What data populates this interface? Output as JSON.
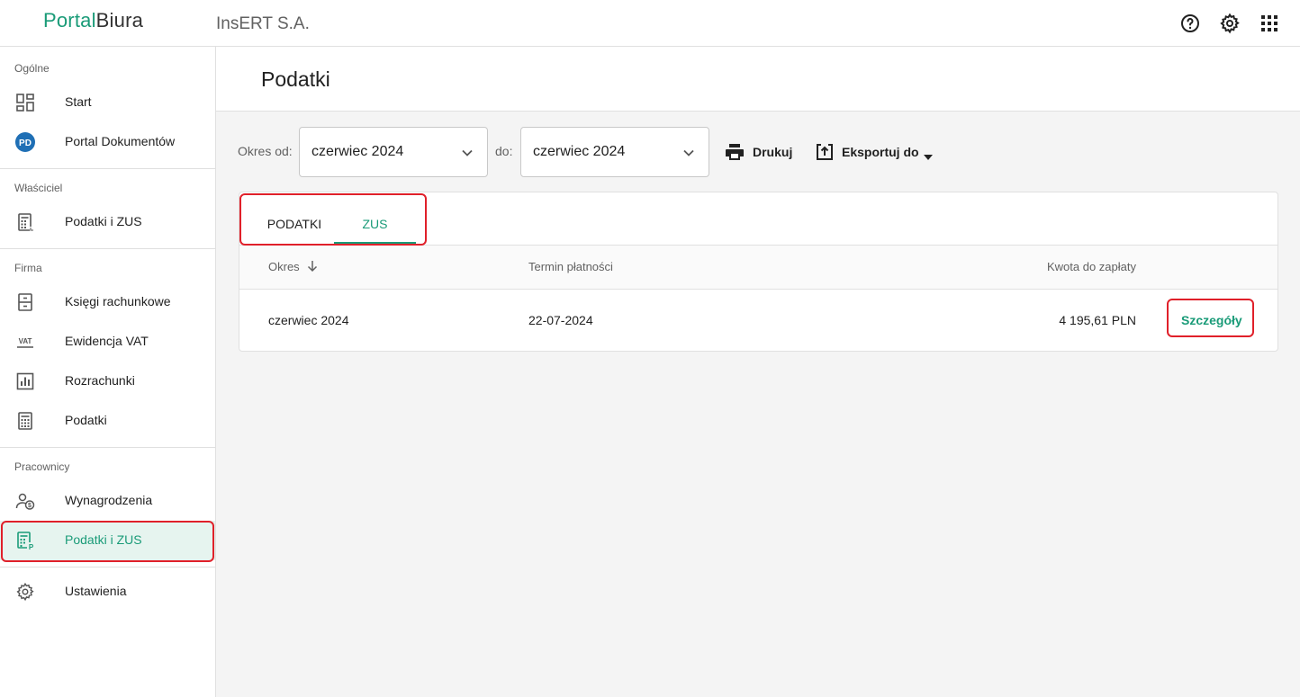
{
  "app": {
    "logo_part1": "Portal",
    "logo_part2": "Biura",
    "company": "InsERT S.A."
  },
  "topbar": {
    "icons": [
      "help-icon",
      "settings-icon",
      "apps-grid-icon"
    ]
  },
  "sidebar": {
    "sections": [
      {
        "label": "Ogólne",
        "items": [
          {
            "label": "Start",
            "icon": "dashboard-icon"
          },
          {
            "label": "Portal Dokumentów",
            "icon": "pd-avatar-icon",
            "badge": "PD"
          }
        ]
      },
      {
        "label": "Właściciel",
        "items": [
          {
            "label": "Podatki i ZUS",
            "icon": "calculator-icon"
          }
        ]
      },
      {
        "label": "Firma",
        "items": [
          {
            "label": "Księgi rachunkowe",
            "icon": "ledger-icon"
          },
          {
            "label": "Ewidencja VAT",
            "icon": "vat-icon",
            "badge": "VAT"
          },
          {
            "label": "Rozrachunki",
            "icon": "bar-chart-icon"
          },
          {
            "label": "Podatki",
            "icon": "calculator-icon"
          }
        ]
      },
      {
        "label": "Pracownicy",
        "items": [
          {
            "label": "Wynagrodzenia",
            "icon": "payroll-icon"
          },
          {
            "label": "Podatki i ZUS",
            "icon": "calculator-p-icon",
            "badge": "P",
            "active": true
          }
        ]
      }
    ],
    "settings": {
      "label": "Ustawienia",
      "icon": "gear-icon"
    }
  },
  "page": {
    "title": "Podatki"
  },
  "filters": {
    "from_label": "Okres od:",
    "from_value": "czerwiec 2024",
    "to_label": "do:",
    "to_value": "czerwiec 2024",
    "print_label": "Drukuj",
    "export_label": "Eksportuj do"
  },
  "tabs": [
    {
      "label": "PODATKI",
      "active": false
    },
    {
      "label": "ZUS",
      "active": true
    }
  ],
  "table": {
    "columns": [
      "Okres",
      "Termin płatności",
      "Kwota do zapłaty"
    ],
    "rows": [
      {
        "period": "czerwiec 2024",
        "due": "22-07-2024",
        "amount": "4 195,61 PLN",
        "action": "Szczegóły"
      }
    ]
  },
  "colors": {
    "accent": "#1a9b78",
    "highlight": "#e0202a",
    "active_bg": "#e6f4ef"
  }
}
